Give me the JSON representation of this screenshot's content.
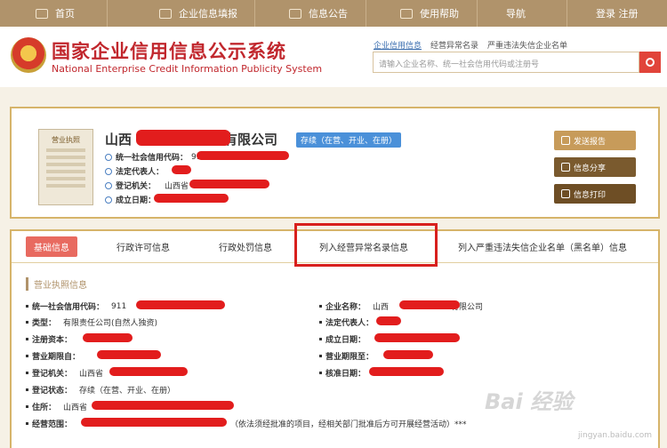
{
  "nav": {
    "items": [
      {
        "label": "首页",
        "icon": "monitor-icon"
      },
      {
        "label": "企业信息填报",
        "icon": "edit-icon"
      },
      {
        "label": "信息公告",
        "icon": "document-icon"
      },
      {
        "label": "使用帮助",
        "icon": "headset-icon"
      },
      {
        "label": "导航",
        "icon": ""
      },
      {
        "label": "登录  注册",
        "icon": ""
      }
    ]
  },
  "header": {
    "title": "国家企业信用信息公示系统",
    "subtitle": "National Enterprise Credit Information Publicity System",
    "search_tabs": [
      "企业信用信息",
      "经营异常名录",
      "严重违法失信企业名单"
    ],
    "search_placeholder": "请输入企业名称、统一社会信用代码或注册号"
  },
  "company": {
    "name_prefix": "山西",
    "name_suffix": "有限公司",
    "status": "存续（在营、开业、在册）",
    "license_label": "营业执照",
    "credit_code_label": "统一社会信用代码：",
    "credit_code_value": "9114",
    "legal_rep_label": "法定代表人：",
    "reg_authority_label": "登记机关：",
    "reg_authority_value": "山西省",
    "est_date_label": "成立日期："
  },
  "actions": {
    "send_report": "发送报告",
    "share": "信息分享",
    "print": "信息打印"
  },
  "tabs": [
    "基础信息",
    "行政许可信息",
    "行政处罚信息",
    "列入经营异常名录信息",
    "列入严重违法失信企业名单（黑名单）信息"
  ],
  "section_title": "营业执照信息",
  "fields": {
    "credit_code_label": "统一社会信用代码：",
    "credit_code_value": "911",
    "type_label": "类型：",
    "type_value": "有限责任公司(自然人独资)",
    "capital_label": "注册资本：",
    "period_from_label": "营业期限自：",
    "authority_label": "登记机关：",
    "authority_value": "山西省",
    "reg_status_label": "登记状态：",
    "reg_status_value": "存续（在营、开业、在册）",
    "address_label": "住所：",
    "address_value": "山西省",
    "scope_label": "经营范围：",
    "scope_value": "（依法须经批准的项目，经相关部门批准后方可开展经营活动）***",
    "name_label": "企业名称：",
    "name_value_prefix": "山西",
    "name_value_suffix": "有限公司",
    "legal_rep_label": "法定代表人：",
    "est_date_label": "成立日期：",
    "period_to_label": "营业期限至：",
    "approval_date_label": "核准日期："
  },
  "watermark": {
    "brand": "Bai 经验",
    "url": "jingyan.baidu.com"
  },
  "colors": {
    "accent": "#b0936b",
    "brand_red": "#c1272d",
    "highlight": "#d8201d",
    "redact": "#e21d1d"
  }
}
